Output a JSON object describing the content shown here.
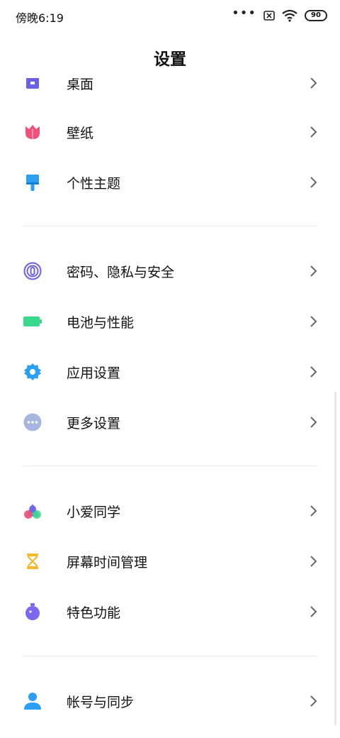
{
  "status_bar": {
    "time": "傍晚6:19",
    "battery": "90",
    "more": "•••"
  },
  "header": {
    "title": "设置"
  },
  "groups": [
    {
      "items": [
        {
          "label": "桌面",
          "icon": "desktop-icon",
          "color": "#6b5fe6"
        },
        {
          "label": "壁纸",
          "icon": "tulip-icon",
          "color": "#f0527a"
        },
        {
          "label": "个性主题",
          "icon": "brush-icon",
          "color": "#2b9ff2"
        }
      ]
    },
    {
      "items": [
        {
          "label": "密码、隐私与安全",
          "icon": "fingerprint-icon",
          "color": "#6b5fe6"
        },
        {
          "label": "电池与性能",
          "icon": "battery-icon",
          "color": "#38d98a"
        },
        {
          "label": "应用设置",
          "icon": "gear-icon",
          "color": "#2b9ff2"
        },
        {
          "label": "更多设置",
          "icon": "more-dots-icon",
          "color": "#a7b6de"
        }
      ]
    },
    {
      "items": [
        {
          "label": "小爱同学",
          "icon": "xiaoai-icon",
          "color": "#5b6cf2"
        },
        {
          "label": "屏幕时间管理",
          "icon": "hourglass-icon",
          "color": "#f5b731"
        },
        {
          "label": "特色功能",
          "icon": "flask-icon",
          "color": "#7a68ee"
        }
      ]
    },
    {
      "items": [
        {
          "label": "帐号与同步",
          "icon": "person-icon",
          "color": "#2b9ff2"
        }
      ]
    }
  ]
}
